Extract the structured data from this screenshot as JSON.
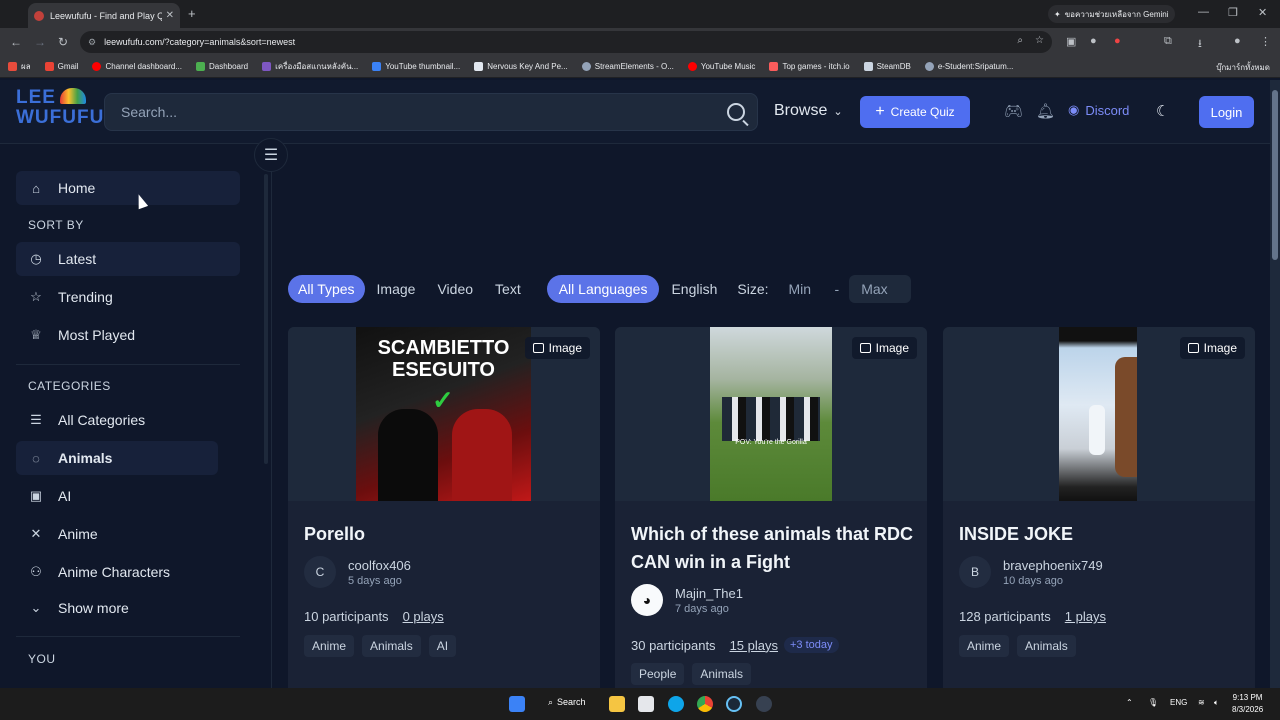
{
  "browser": {
    "tab_title": "Leewufufu - Find and Play Qui...",
    "gemini_label": "ขอความช่วยเหลือจาก Gemini",
    "url": "leewufufu.com/?category=animals&sort=newest",
    "bookmarks": [
      {
        "label": "ผล",
        "color": "#e74c3c"
      },
      {
        "label": "Gmail",
        "color": "#ea4335"
      },
      {
        "label": "Channel dashboard...",
        "color": "#ff0000"
      },
      {
        "label": "Dashboard",
        "color": "#4caf50"
      },
      {
        "label": "เครื่องมือสแกนหลังคัน...",
        "color": "#7e57c2"
      },
      {
        "label": "YouTube thumbnail...",
        "color": "#3b82f6"
      },
      {
        "label": "Nervous Key And Pe...",
        "color": "#e2e8f0"
      },
      {
        "label": "StreamElements - O...",
        "color": "#94a3b8"
      },
      {
        "label": "YouTube Music",
        "color": "#ff0000"
      },
      {
        "label": "Top games - itch.io",
        "color": "#fa5c5c"
      },
      {
        "label": "SteamDB",
        "color": "#cbd5e1"
      },
      {
        "label": "e-Student:Sripatum...",
        "color": "#94a3b8"
      }
    ],
    "bookmarks_right": "บุ๊กมาร์กทั้งหมด"
  },
  "nav": {
    "logo_line1": "LEE",
    "logo_line2": "WUFUFU",
    "search_placeholder": "Search...",
    "browse": "Browse",
    "create": "Create Quiz",
    "discord": "Discord",
    "login": "Login"
  },
  "sidebar": {
    "home": "Home",
    "sort_head": "SORT BY",
    "sort": [
      "Latest",
      "Trending",
      "Most Played"
    ],
    "cat_head": "CATEGORIES",
    "categories": [
      "All Categories",
      "Animals",
      "AI",
      "Anime",
      "Anime Characters"
    ],
    "show_more": "Show more",
    "you_head": "YOU"
  },
  "filters": {
    "types": [
      "All Types",
      "Image",
      "Video",
      "Text"
    ],
    "languages": [
      "All Languages",
      "English"
    ],
    "size_label": "Size:",
    "min": "Min",
    "dash": "-",
    "max": "Max"
  },
  "cards": [
    {
      "badge": "Image",
      "title": "Porello",
      "avatar": "C",
      "author": "coolfox406",
      "date": "5 days ago",
      "participants": "10 participants",
      "plays": "0 plays",
      "tags": [
        "Anime",
        "Animals",
        "AI"
      ],
      "thumb_text1": "SCAMBIETTO",
      "thumb_text2": "ESEGUITO"
    },
    {
      "badge": "Image",
      "title": "Which of these animals that RDC CAN win in a Fight",
      "author": "Majin_The1",
      "date": "7 days ago",
      "participants": "30 participants",
      "plays": "15 plays",
      "today": "+3 today",
      "tags": [
        "People",
        "Animals"
      ],
      "thumb_caption": "POV: You're the Gorilla"
    },
    {
      "badge": "Image",
      "title": "INSIDE JOKE",
      "avatar": "B",
      "author": "bravephoenix749",
      "date": "10 days ago",
      "participants": "128 participants",
      "plays": "1 plays",
      "tags": [
        "Anime",
        "Animals"
      ]
    }
  ],
  "taskbar": {
    "search": "Search",
    "lang": "ENG",
    "time": "9:13 PM",
    "date": "8/3/2026"
  }
}
